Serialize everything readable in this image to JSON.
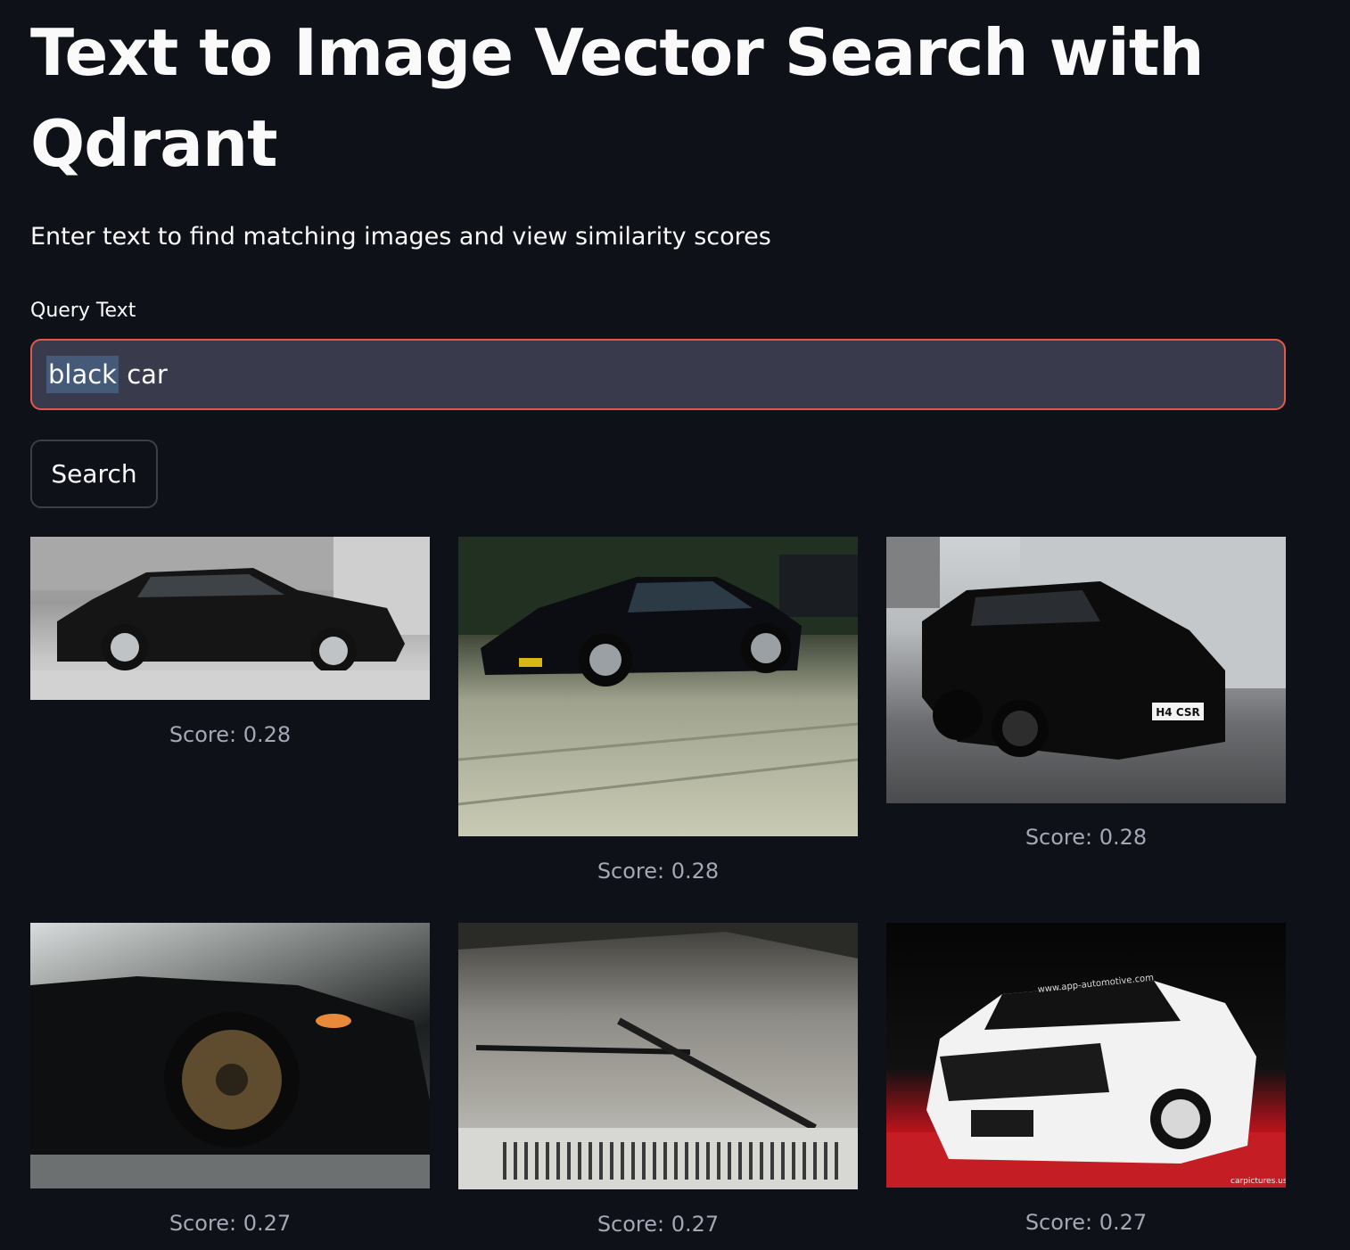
{
  "header": {
    "title": "Text to Image Vector Search with Qdrant",
    "subtitle": "Enter text to find matching images and view similarity scores"
  },
  "query": {
    "label": "Query Text",
    "value_selected": "black",
    "value_rest": " car"
  },
  "search_button": {
    "label": "Search"
  },
  "results": [
    {
      "score_label": "Score: 0.28"
    },
    {
      "score_label": "Score: 0.28"
    },
    {
      "score_label": "Score: 0.28",
      "plate_text": "H4 CSR"
    },
    {
      "score_label": "Score: 0.27"
    },
    {
      "score_label": "Score: 0.27"
    },
    {
      "score_label": "Score: 0.27",
      "watermark_text": "carpictures.us",
      "banner_text": "www.app-automotive.com"
    }
  ],
  "colors": {
    "background": "#0e1117",
    "input_background": "#393b4c",
    "input_focus_border": "#e2594c",
    "selection_highlight": "#445a78",
    "score_text": "#a3a8b4"
  }
}
